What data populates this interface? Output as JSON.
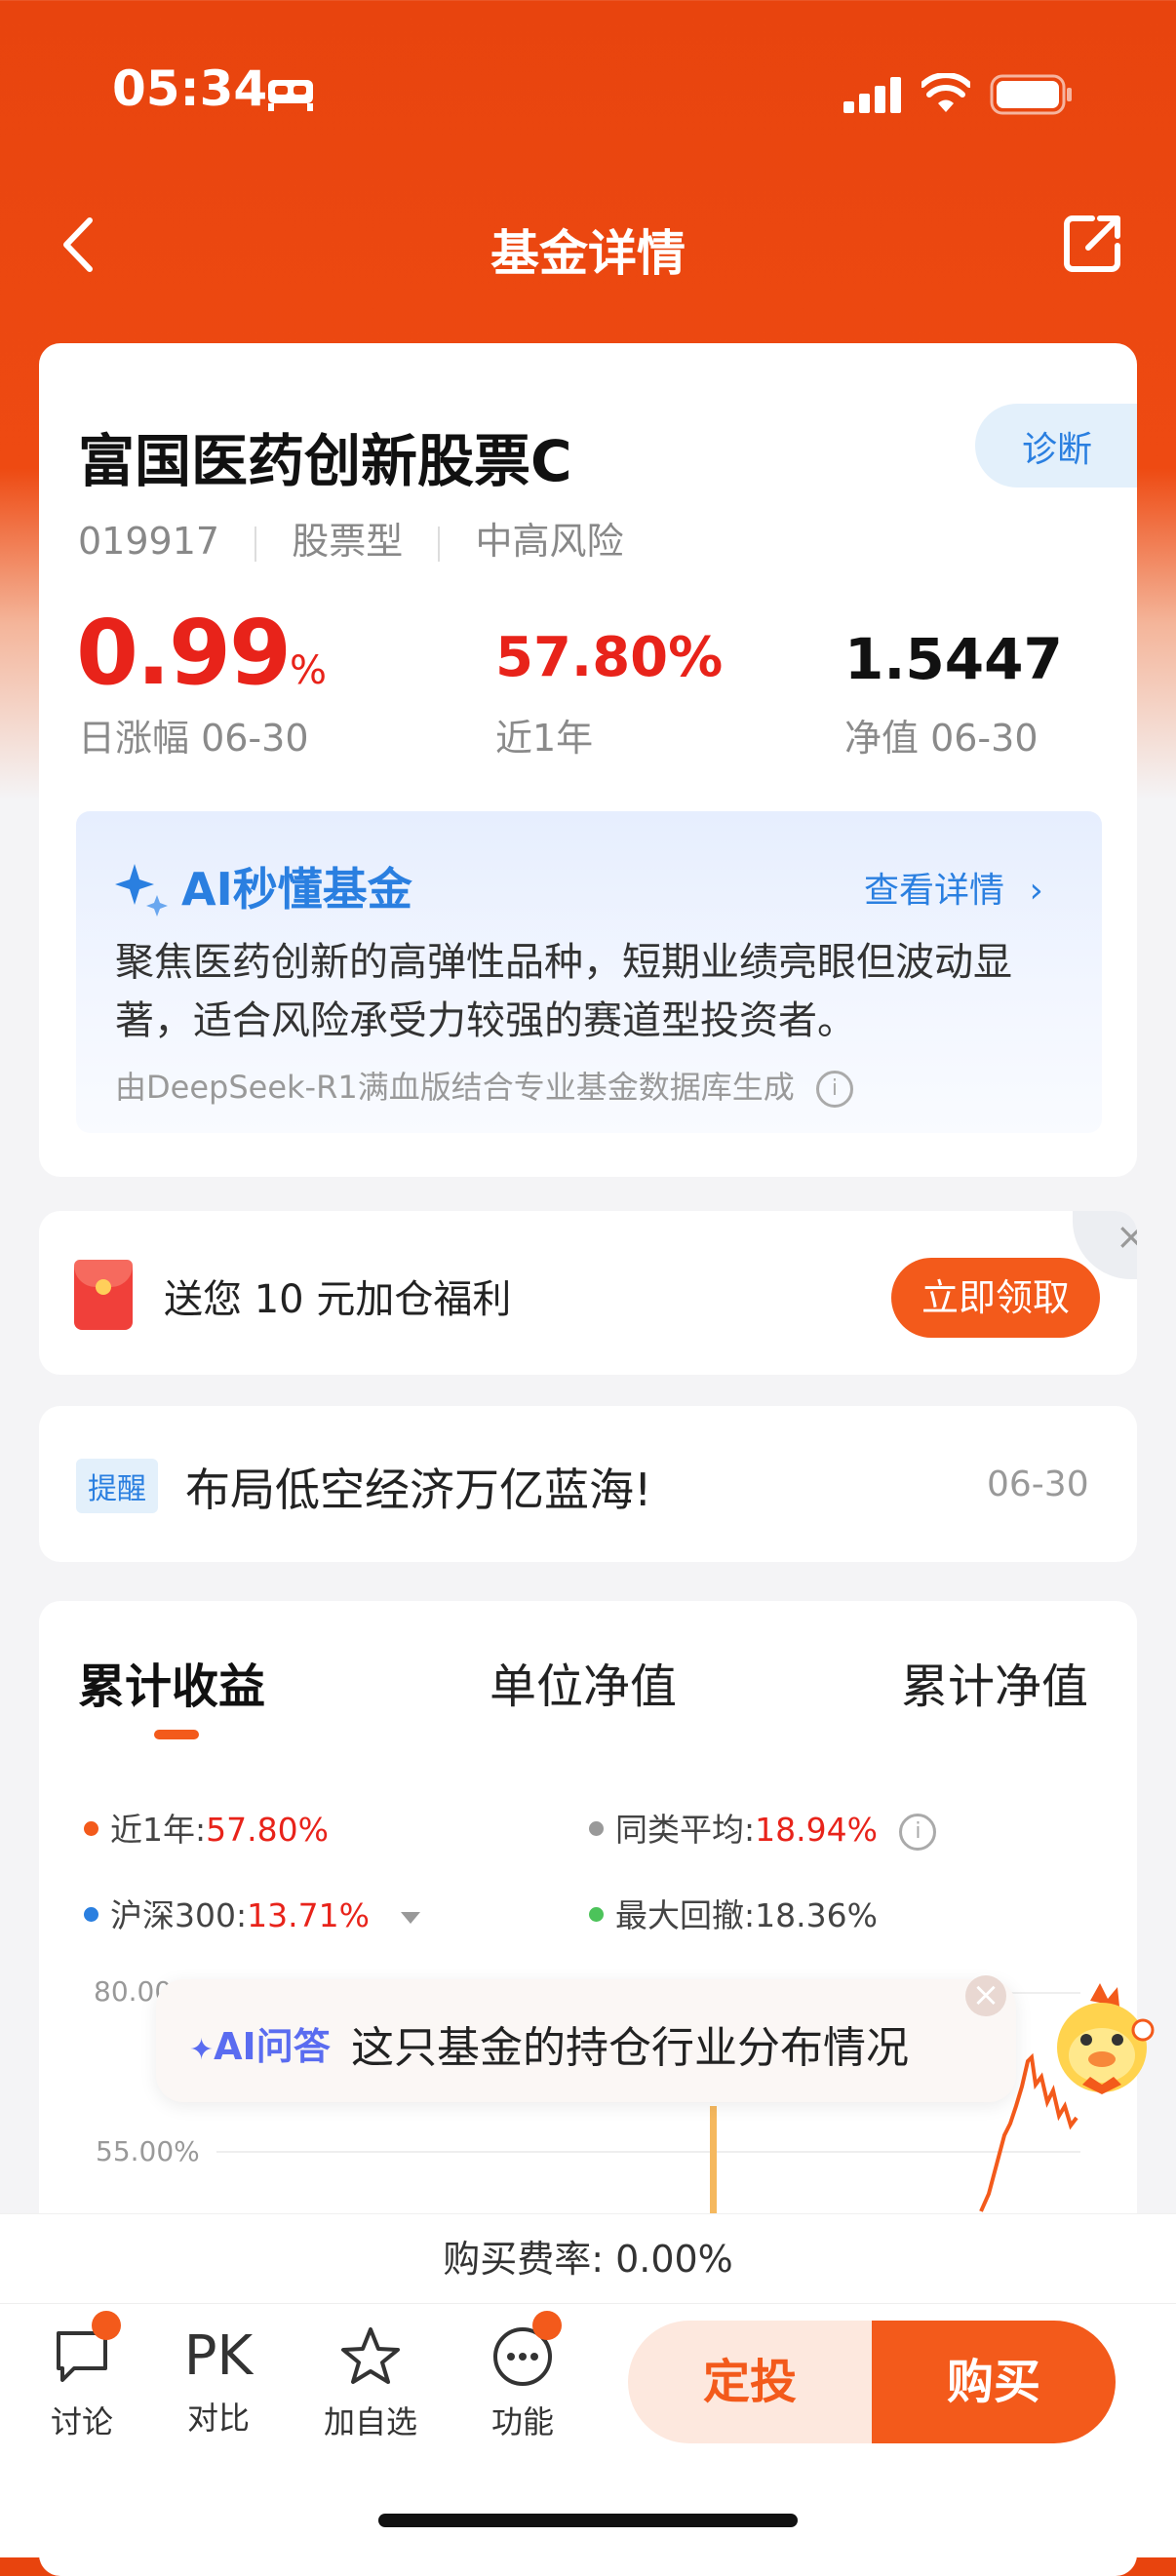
{
  "status_bar": {
    "time": "05:34"
  },
  "nav": {
    "title": "基金详情"
  },
  "fund": {
    "name": "富国医药创新股票C",
    "code": "019917",
    "type": "股票型",
    "risk": "中高风险",
    "diagnose_label": "诊断",
    "daily_change_value": "0.99",
    "daily_change_unit": "%",
    "daily_change_label": "日涨幅 06-30",
    "year_return_value": "57.80%",
    "year_return_label": "近1年",
    "nav_value": "1.5447",
    "nav_label": "净值 06-30"
  },
  "ai_card": {
    "title": "AI秒懂基金",
    "link": "查看详情",
    "summary": "聚焦医药创新的高弹性品种，短期业绩亮眼但波动显著，适合风险承受力较强的赛道型投资者。",
    "source": "由DeepSeek-R1满血版结合专业基金数据库生成"
  },
  "promo": {
    "text": "送您 10 元加仓福利",
    "button": "立即领取"
  },
  "notice": {
    "badge": "提醒",
    "text": "布局低空经济万亿蓝海!",
    "date": "06-30"
  },
  "chart_tabs": [
    "累计收益",
    "单位净值",
    "累计净值"
  ],
  "legend": {
    "year_label": "近1年:",
    "year_value": "57.80%",
    "avg_label": "同类平均:",
    "avg_value": "18.94%",
    "hs300_label": "沪深300:",
    "hs300_value": "13.71%",
    "drawdown_label": "最大回撤:",
    "drawdown_value": "18.36%"
  },
  "chart": {
    "y_top": "80.00%",
    "y_mid": "55.00%"
  },
  "ai_qa": {
    "label": "AI问答",
    "question": "这只基金的持仓行业分布情况"
  },
  "fee": {
    "text": "购买费率:  0.00%"
  },
  "bottom_bar": {
    "discuss": "讨论",
    "compare_icon": "PK",
    "compare": "对比",
    "watchlist": "加自选",
    "functions": "功能",
    "sip_button": "定投",
    "buy_button": "购买"
  },
  "colors": {
    "brand": "#e8440e",
    "up_red": "#e8231a",
    "link_blue": "#2a7fe0"
  }
}
